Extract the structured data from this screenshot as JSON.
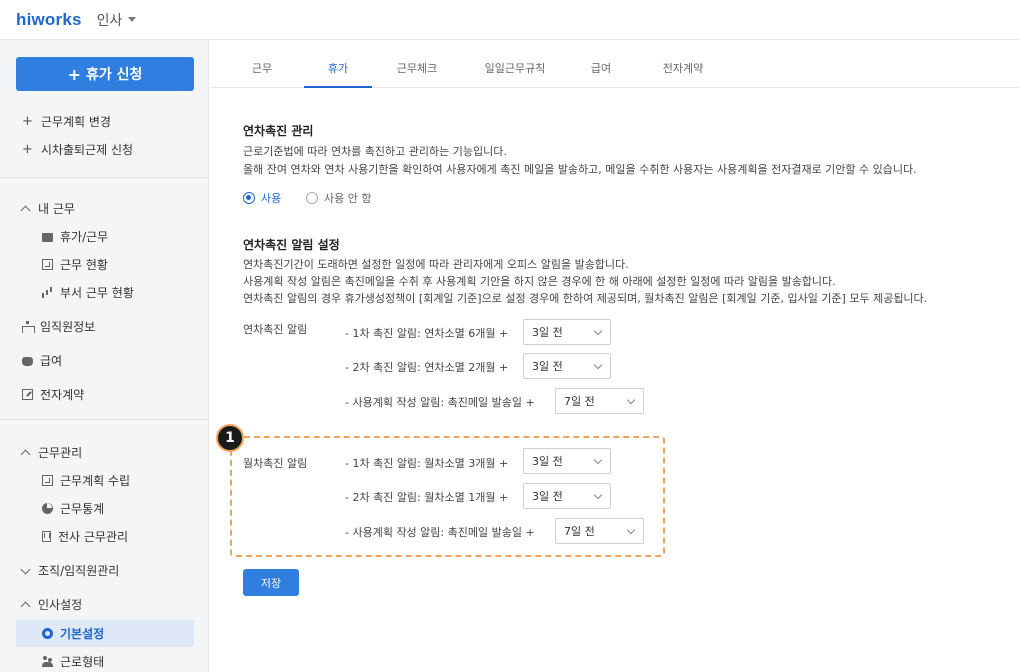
{
  "app": {
    "logo": "hiworks",
    "module": "인사"
  },
  "sidebar": {
    "primary_button": "휴가 신청",
    "links": [
      "근무계획 변경",
      "시차출퇴근제 신청"
    ],
    "my_work": {
      "label": "내 근무",
      "items": [
        "휴가/근무",
        "근무 현황",
        "부서 근무 현황"
      ]
    },
    "top_items": [
      "임직원정보",
      "급여",
      "전자계약"
    ],
    "work_mgmt": {
      "label": "근무관리",
      "items": [
        "근무계획 수립",
        "근무통계",
        "전사 근무관리"
      ]
    },
    "org_mgmt": {
      "label": "조직/임직원관리"
    },
    "hr_settings": {
      "label": "인사설정",
      "items": [
        "기본설정",
        "근로형태"
      ]
    }
  },
  "tabs": [
    "근무",
    "휴가",
    "근무체크",
    "일일근무규칙",
    "급여",
    "전자계약"
  ],
  "active_tab": "휴가",
  "section1": {
    "title": "연차촉진 관리",
    "desc1": "근로기준법에 따라 연차를 촉진하고 관리하는 기능입니다.",
    "desc2": "올해 잔여 연차와 연차 사용기한을 확인하여 사용자에게 촉진 메일을 발송하고, 메일을 수취한 사용자는 사용계획을 전자결재로 기안할 수 있습니다.",
    "radio_use": "사용",
    "radio_not_use": "사용 안 함"
  },
  "section2": {
    "title": "연차촉진 알림 설정",
    "desc1": "연차촉진기간이 도래하면 설정한 일정에 따라 관리자에게 오피스 알림을 발송합니다.",
    "desc2": "사용계획 작성 알림은 촉진메일을 수취 후 사용계획 기안을 하지 않은 경우에 한 해 아래에 설정한 일정에 따라 알림을 발송합니다.",
    "desc3": "연차촉진 알림의 경우 휴가생성정책이 [회계일 기준]으로 설정 경우에 한하여 제공되며, 월차촉진 알림은 [회계일 기준, 입사일 기준] 모두 제공됩니다."
  },
  "annual": {
    "label": "연차촉진 알림",
    "rows": [
      {
        "text": "- 1차 촉진 알림: 연차소멸 6개월 +",
        "value": "3일 전"
      },
      {
        "text": "- 2차 촉진 알림: 연차소멸 2개월 +",
        "value": "3일 전"
      },
      {
        "text": "- 사용계획 작성 알림: 촉진메일 발송일 +",
        "value": "7일 전"
      }
    ]
  },
  "monthly": {
    "badge": "1",
    "label": "월차촉진 알림",
    "rows": [
      {
        "text": "- 1차 촉진 알림: 월차소멸 3개월 +",
        "value": "3일 전"
      },
      {
        "text": "- 2차 촉진 알림: 월차소멸 1개월 +",
        "value": "3일 전"
      },
      {
        "text": "- 사용계획 작성 알림: 촉진메일 발송일 +",
        "value": "7일 전"
      }
    ]
  },
  "save_button": "저장",
  "colors": {
    "accent": "#2f7ee0",
    "highlight": "#f0a35a"
  }
}
